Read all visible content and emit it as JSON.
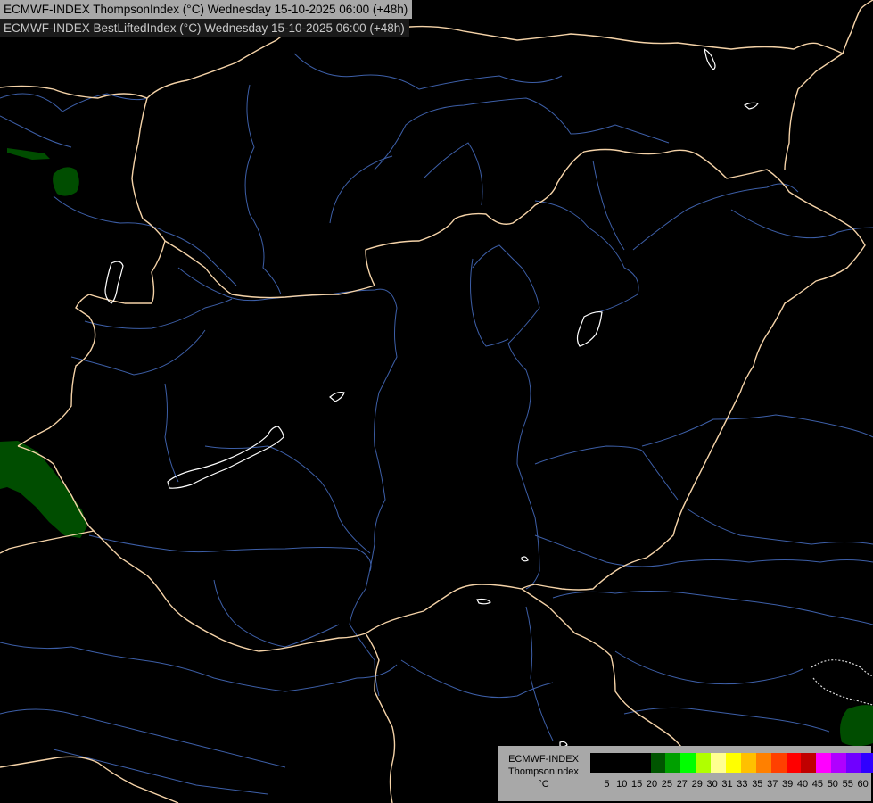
{
  "header": {
    "line1": "ECMWF-INDEX ThompsonIndex (°C) Wednesday 15-10-2025 06:00 (+48h)",
    "line2": "ECMWF-INDEX BestLiftedIndex (°C) Wednesday 15-10-2025 06:00 (+48h)"
  },
  "legend": {
    "model": "ECMWF-INDEX",
    "parameter": "ThompsonIndex",
    "unit": "°C",
    "colors": [
      "#000000",
      "#000000",
      "#000000",
      "#000000",
      "#005500",
      "#00a000",
      "#00ff00",
      "#b0ff00",
      "#ffff90",
      "#ffff00",
      "#ffc000",
      "#ff8000",
      "#ff4000",
      "#ff0000",
      "#c00000",
      "#ff00ff",
      "#b000ff",
      "#7000ff",
      "#3000ff",
      "#0000ff"
    ],
    "ticks": [
      "5",
      "10",
      "15",
      "20",
      "25",
      "27",
      "29",
      "30",
      "31",
      "33",
      "35",
      "37",
      "39",
      "40",
      "45",
      "50",
      "55",
      "60"
    ]
  },
  "map": {
    "layers": [
      "country-borders",
      "rivers",
      "lakes",
      "thompson-index-fill",
      "lifted-index-contour"
    ]
  }
}
